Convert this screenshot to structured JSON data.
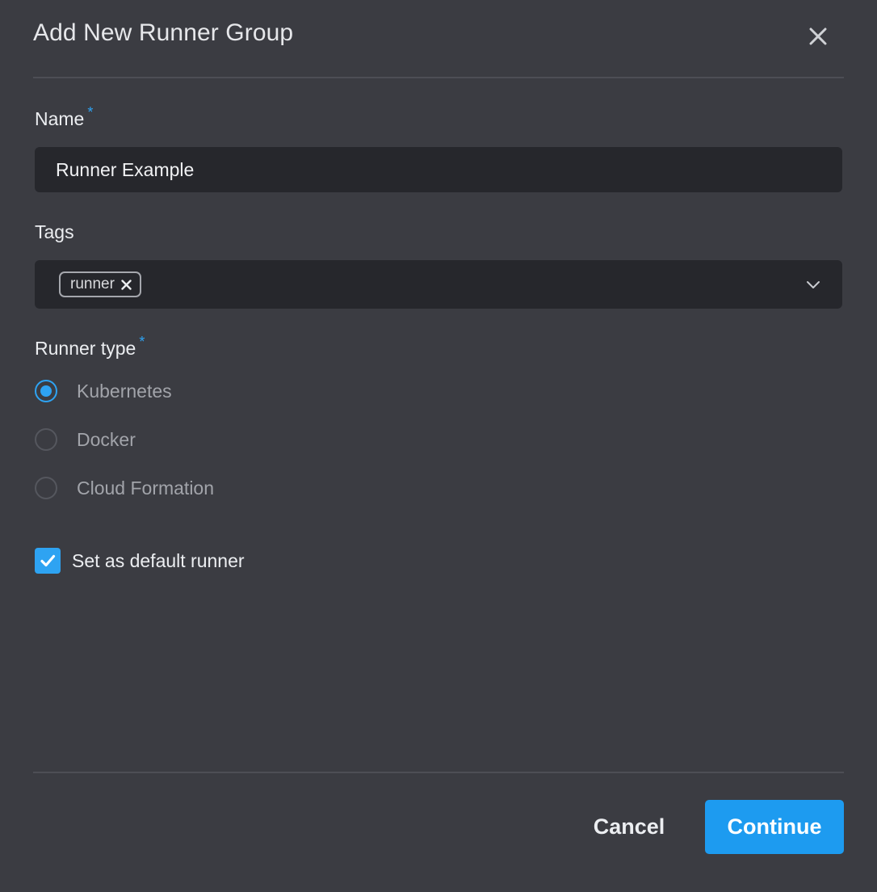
{
  "dialog": {
    "title": "Add New Runner Group",
    "close_icon": "close-icon"
  },
  "name_field": {
    "label": "Name",
    "required_marker": "*",
    "value": "Runner Example"
  },
  "tags_field": {
    "label": "Tags",
    "tags": [
      {
        "label": "runner",
        "remove_icon": "close-icon"
      }
    ],
    "dropdown_icon": "chevron-down-icon"
  },
  "runner_type": {
    "label": "Runner type",
    "required_marker": "*",
    "options": [
      {
        "label": "Kubernetes",
        "selected": true
      },
      {
        "label": "Docker",
        "selected": false
      },
      {
        "label": "Cloud Formation",
        "selected": false
      }
    ]
  },
  "default_runner": {
    "label": "Set as default runner",
    "checked": true
  },
  "footer": {
    "cancel_label": "Cancel",
    "continue_label": "Continue"
  },
  "colors": {
    "background": "#3b3c42",
    "input_background": "#26272c",
    "accent": "#1d9bf0",
    "divider": "#4d4e55"
  }
}
